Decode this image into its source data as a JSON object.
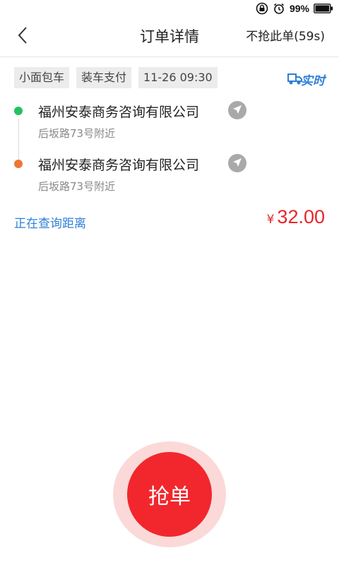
{
  "status_bar": {
    "battery_percent": "99%",
    "icons": [
      "lock-rotation-icon",
      "alarm-icon",
      "battery-icon"
    ]
  },
  "header": {
    "title": "订单详情",
    "skip_label": "不抢此单(59s)",
    "back_icon": "chevron-left-icon"
  },
  "order": {
    "tags": [
      "小面包车",
      "装车支付",
      "11-26 09:30"
    ],
    "realtime_label": "实时",
    "pickup": {
      "name": "福州安泰商务咨询有限公司",
      "detail": "后坂路73号附近"
    },
    "dropoff": {
      "name": "福州安泰商务咨询有限公司",
      "detail": "后坂路73号附近"
    },
    "distance_label": "正在查询距离",
    "price_symbol": "¥",
    "price_value": "32.00"
  },
  "actions": {
    "grab_label": "抢单"
  },
  "colors": {
    "accent_red": "#f1272d",
    "link_blue": "#2f7fd6",
    "start_green": "#22c35e",
    "end_orange": "#f07535"
  }
}
